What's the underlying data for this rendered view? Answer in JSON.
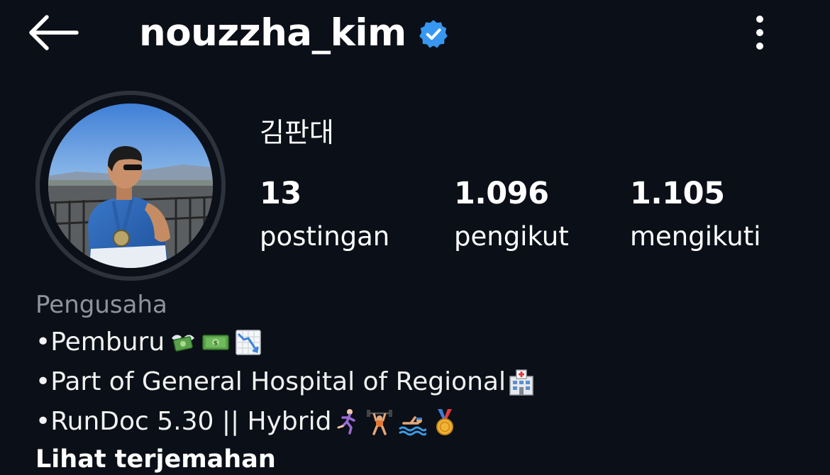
{
  "header": {
    "username": "nouzzha_kim",
    "back_icon": "arrow-left-icon",
    "verified_icon": "verified-badge-icon",
    "verified_color": "#3897f0",
    "more_icon": "more-vertical-icon"
  },
  "profile": {
    "display_name": "김판대",
    "avatar": "profile-photo"
  },
  "stats": [
    {
      "value": "13",
      "label": "postingan"
    },
    {
      "value": "1.096",
      "label": "pengikut"
    },
    {
      "value": "1.105",
      "label": "mengikuti"
    }
  ],
  "bio": {
    "category": "Pengusaha",
    "lines": [
      {
        "text": "•Pemburu ",
        "emojis": [
          "money-with-wings-icon",
          "dollar-banknote-icon",
          "chart-decreasing-icon"
        ]
      },
      {
        "text": "•Part of General Hospital of Regional",
        "emojis": [
          "hospital-icon"
        ]
      },
      {
        "text": "•RunDoc 5.30 || Hybrid",
        "emojis": [
          "woman-running-icon",
          "person-lifting-weights-icon",
          "person-swimming-icon",
          "sports-medal-icon"
        ]
      }
    ],
    "see_translation": "Lihat terjemahan"
  },
  "colors": {
    "background": "#0b0f17",
    "text": "#ffffff",
    "category_text": "#8e949e",
    "avatar_ring": "#2d333d"
  }
}
